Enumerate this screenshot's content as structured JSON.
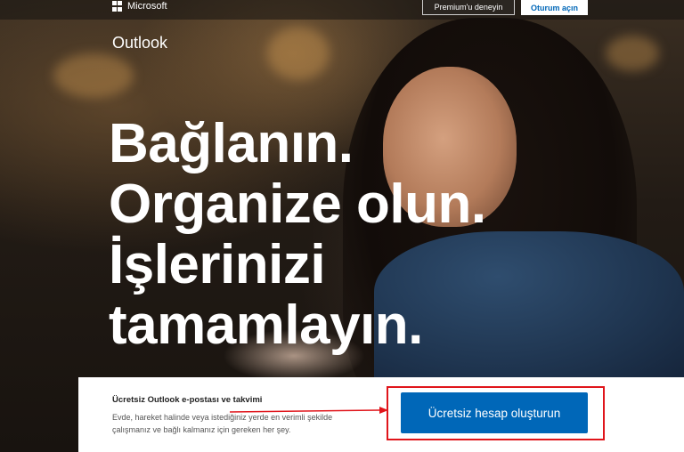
{
  "header": {
    "brand": "Microsoft",
    "premium_button": "Premium'u deneyin",
    "signin_button": "Oturum açın"
  },
  "hero": {
    "product": "Outlook",
    "headline_lines": [
      "Bağlanın.",
      "Organize olun.",
      "İşlerinizi",
      "tamamlayın."
    ]
  },
  "signup_panel": {
    "title": "Ücretsiz Outlook e-postası ve takvimi",
    "description": "Evde, hareket halinde veya istediğiniz yerde en verimli şekilde çalışmanız ve bağlı kalmanız için gereken her şey.",
    "cta": "Ücretsiz hesap oluşturun"
  },
  "colors": {
    "accent": "#0067b8",
    "highlight": "#e0151b",
    "panel_bg": "#ffffff"
  },
  "icons": {
    "logo": "microsoft-logo-icon"
  }
}
